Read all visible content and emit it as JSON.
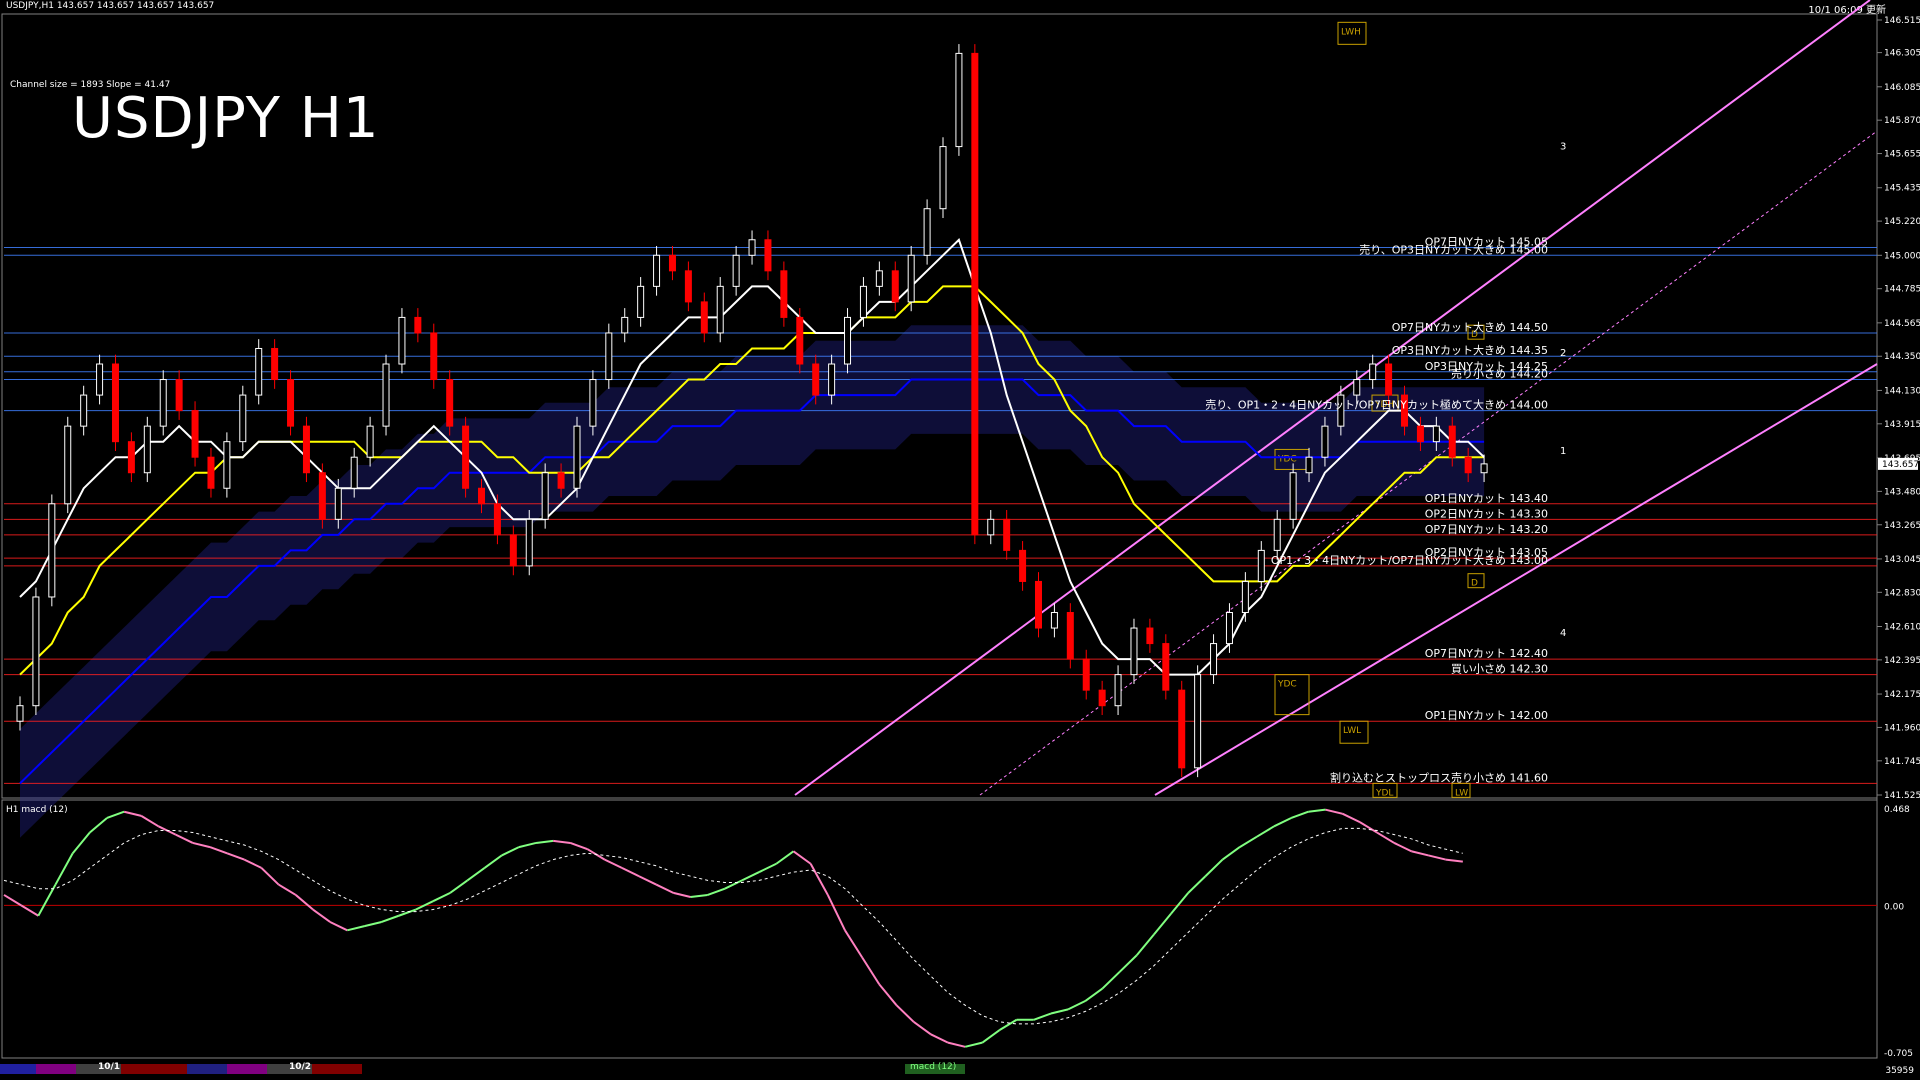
{
  "window": {
    "symbol_info": "USDJPY,H1  143.657 143.657 143.657 143.657",
    "server_time": "10/1 06:09 更新",
    "channel_info": "Channel size = 1893 Slope = 41.47",
    "title": "USDJPY H1",
    "subwindow_label": "H1  macd (12)",
    "corner_number": "35959",
    "bottom_tabs": [
      "10/1",
      "10/2"
    ],
    "macd_tab": "macd (12)"
  },
  "colors": {
    "background": "#000000",
    "bull_candle": "#ffffff",
    "bear_candle": "#ff0000",
    "sma_white": "#ffffff",
    "sma_yellow": "#ffff00",
    "sma_blue": "#0000ff",
    "ichimoku_span": "#008000",
    "channel": "#ff80ff",
    "macd_up": "#80ff80",
    "macd_down": "#ff80c0",
    "macd_signal": "#ffffff"
  },
  "chart_data": {
    "type": "candlestick",
    "title": "USDJPY H1",
    "ylim": [
      141.525,
      146.515
    ],
    "y_ticks": [
      "146.515",
      "146.305",
      "146.085",
      "145.870",
      "145.655",
      "145.435",
      "145.220",
      "145.000",
      "144.785",
      "144.565",
      "144.350",
      "144.130",
      "143.915",
      "143.695",
      "143.480",
      "143.265",
      "143.045",
      "142.830",
      "142.610",
      "142.395",
      "142.175",
      "141.960",
      "141.745",
      "141.525"
    ],
    "current_price": "143.657",
    "closes": [
      142.1,
      142.8,
      143.4,
      143.9,
      144.1,
      144.3,
      143.8,
      143.6,
      143.9,
      144.2,
      144.0,
      143.7,
      143.5,
      143.8,
      144.1,
      144.4,
      144.2,
      143.9,
      143.6,
      143.3,
      143.5,
      143.7,
      143.9,
      144.3,
      144.6,
      144.5,
      144.2,
      143.9,
      143.5,
      143.4,
      143.2,
      143.0,
      143.3,
      143.6,
      143.5,
      143.9,
      144.2,
      144.5,
      144.6,
      144.8,
      145.0,
      144.9,
      144.7,
      144.5,
      144.8,
      145.0,
      145.1,
      144.9,
      144.6,
      144.3,
      144.1,
      144.3,
      144.6,
      144.8,
      144.9,
      144.7,
      145.0,
      145.3,
      145.7,
      146.3,
      143.2,
      143.3,
      143.1,
      142.9,
      142.6,
      142.7,
      142.4,
      142.2,
      142.1,
      142.3,
      142.6,
      142.5,
      142.2,
      141.7,
      142.3,
      142.5,
      142.7,
      142.9,
      143.1,
      143.3,
      143.6,
      143.7,
      143.9,
      144.1,
      144.2,
      144.3,
      144.1,
      143.9,
      143.8,
      143.9,
      143.7,
      143.6,
      143.657
    ],
    "sma_white": [
      142.8,
      142.9,
      143.1,
      143.3,
      143.5,
      143.6,
      143.7,
      143.7,
      143.8,
      143.8,
      143.9,
      143.8,
      143.8,
      143.7,
      143.7,
      143.8,
      143.8,
      143.8,
      143.7,
      143.6,
      143.5,
      143.5,
      143.5,
      143.6,
      143.7,
      143.8,
      143.9,
      143.8,
      143.7,
      143.6,
      143.4,
      143.3,
      143.3,
      143.3,
      143.4,
      143.5,
      143.7,
      143.9,
      144.1,
      144.3,
      144.4,
      144.5,
      144.6,
      144.6,
      144.6,
      144.7,
      144.8,
      144.8,
      144.7,
      144.6,
      144.5,
      144.5,
      144.5,
      144.6,
      144.7,
      144.7,
      144.8,
      144.9,
      145.0,
      145.1,
      144.8,
      144.5,
      144.1,
      143.8,
      143.5,
      143.2,
      142.9,
      142.7,
      142.5,
      142.4,
      142.4,
      142.4,
      142.3,
      142.3,
      142.3,
      142.4,
      142.5,
      142.7,
      142.8,
      143.0,
      143.2,
      143.4,
      143.6,
      143.7,
      143.8,
      143.9,
      144.0,
      144.0,
      143.9,
      143.9,
      143.8,
      143.8,
      143.7
    ],
    "sma_yellow": [
      142.3,
      142.4,
      142.5,
      142.7,
      142.8,
      143.0,
      143.1,
      143.2,
      143.3,
      143.4,
      143.5,
      143.6,
      143.6,
      143.7,
      143.7,
      143.8,
      143.8,
      143.8,
      143.8,
      143.8,
      143.8,
      143.8,
      143.7,
      143.7,
      143.7,
      143.8,
      143.8,
      143.8,
      143.8,
      143.8,
      143.7,
      143.7,
      143.6,
      143.6,
      143.6,
      143.6,
      143.7,
      143.7,
      143.8,
      143.9,
      144.0,
      144.1,
      144.2,
      144.2,
      144.3,
      144.3,
      144.4,
      144.4,
      144.4,
      144.5,
      144.5,
      144.5,
      144.5,
      144.6,
      144.6,
      144.6,
      144.7,
      144.7,
      144.8,
      144.8,
      144.8,
      144.7,
      144.6,
      144.5,
      144.3,
      144.2,
      144.0,
      143.9,
      143.7,
      143.6,
      143.4,
      143.3,
      143.2,
      143.1,
      143.0,
      142.9,
      142.9,
      142.9,
      142.9,
      142.9,
      143.0,
      143.0,
      143.1,
      143.2,
      143.3,
      143.4,
      143.5,
      143.6,
      143.6,
      143.7,
      143.7,
      143.7,
      143.7
    ],
    "sma_blue": [
      141.6,
      141.7,
      141.8,
      141.9,
      142.0,
      142.1,
      142.2,
      142.3,
      142.4,
      142.5,
      142.6,
      142.7,
      142.8,
      142.8,
      142.9,
      143.0,
      143.0,
      143.1,
      143.1,
      143.2,
      143.2,
      143.3,
      143.3,
      143.4,
      143.4,
      143.5,
      143.5,
      143.6,
      143.6,
      143.6,
      143.6,
      143.6,
      143.6,
      143.7,
      143.7,
      143.7,
      143.7,
      143.8,
      143.8,
      143.8,
      143.8,
      143.9,
      143.9,
      143.9,
      143.9,
      144.0,
      144.0,
      144.0,
      144.0,
      144.0,
      144.1,
      144.1,
      144.1,
      144.1,
      144.1,
      144.1,
      144.2,
      144.2,
      144.2,
      144.2,
      144.2,
      144.2,
      144.2,
      144.2,
      144.1,
      144.1,
      144.1,
      144.0,
      144.0,
      144.0,
      143.9,
      143.9,
      143.9,
      143.8,
      143.8,
      143.8,
      143.8,
      143.8,
      143.7,
      143.7,
      143.7,
      143.7,
      143.7,
      143.7,
      143.8,
      143.8,
      143.8,
      143.8,
      143.8,
      143.8,
      143.8,
      143.8,
      143.8
    ],
    "horizontal_levels": [
      {
        "price": 145.05,
        "label": "OP7日NYカット 145.05",
        "color": "#4080ff"
      },
      {
        "price": 145.0,
        "label": "売り、OP3日NYカット大きめ 145.00",
        "color": "#4080ff"
      },
      {
        "price": 144.5,
        "label": "OP7日NYカット大きめ 144.50",
        "color": "#4080ff"
      },
      {
        "price": 144.35,
        "label": "OP3日NYカット大きめ 144.35",
        "color": "#4080ff"
      },
      {
        "price": 144.25,
        "label": "OP3日NYカット 144.25",
        "color": "#4080ff"
      },
      {
        "price": 144.2,
        "label": "売り小さめ 144.20",
        "color": "#4080ff"
      },
      {
        "price": 144.0,
        "label": "売り、OP1・2・4日NYカット/OP7日NYカット極めて大きめ 144.00",
        "color": "#4080ff"
      },
      {
        "price": 143.4,
        "label": "OP1日NYカット 143.40",
        "color": "#ff2020"
      },
      {
        "price": 143.3,
        "label": "OP2日NYカット 143.30",
        "color": "#ff2020"
      },
      {
        "price": 143.2,
        "label": "OP7日NYカット 143.20",
        "color": "#ff2020"
      },
      {
        "price": 143.05,
        "label": "OP2日NYカット 143.05",
        "color": "#ff2020"
      },
      {
        "price": 143.0,
        "label": "OP1・3・4日NYカット/OP7日NYカット大きめ 143.00",
        "color": "#ff2020"
      },
      {
        "price": 142.4,
        "label": "OP7日NYカット 142.40",
        "color": "#ff2020"
      },
      {
        "price": 142.3,
        "label": "買い小さめ 142.30",
        "color": "#ff2020"
      },
      {
        "price": 142.0,
        "label": "OP1日NYカット 142.00",
        "color": "#ff2020"
      },
      {
        "price": 141.6,
        "label": "割り込むとストップロス売り小さめ 141.60",
        "color": "#ff2020"
      }
    ],
    "box_labels": [
      "LWH",
      "YDH",
      "YDC",
      "YDC",
      "YDL",
      "LWL",
      "LW",
      "D",
      "D"
    ],
    "channel_labels": [
      "3",
      "2",
      "1",
      "4"
    ],
    "macd": {
      "ylim": [
        -0.705,
        0.468
      ],
      "y_ticks": [
        "0.468",
        "0.00",
        "-0.705"
      ],
      "main": [
        0.05,
        0.0,
        -0.05,
        0.1,
        0.25,
        0.35,
        0.42,
        0.45,
        0.43,
        0.38,
        0.34,
        0.3,
        0.28,
        0.25,
        0.22,
        0.18,
        0.1,
        0.05,
        -0.02,
        -0.08,
        -0.12,
        -0.1,
        -0.08,
        -0.05,
        -0.02,
        0.02,
        0.06,
        0.12,
        0.18,
        0.24,
        0.28,
        0.3,
        0.31,
        0.3,
        0.27,
        0.22,
        0.18,
        0.14,
        0.1,
        0.06,
        0.04,
        0.05,
        0.08,
        0.12,
        0.16,
        0.2,
        0.26,
        0.2,
        0.05,
        -0.12,
        -0.25,
        -0.38,
        -0.48,
        -0.56,
        -0.62,
        -0.66,
        -0.68,
        -0.66,
        -0.6,
        -0.55,
        -0.55,
        -0.52,
        -0.5,
        -0.46,
        -0.4,
        -0.32,
        -0.24,
        -0.14,
        -0.04,
        0.06,
        0.14,
        0.22,
        0.28,
        0.33,
        0.38,
        0.42,
        0.45,
        0.46,
        0.44,
        0.4,
        0.35,
        0.3,
        0.26,
        0.24,
        0.22,
        0.21
      ],
      "signal": [
        0.12,
        0.1,
        0.08,
        0.08,
        0.12,
        0.18,
        0.24,
        0.3,
        0.34,
        0.36,
        0.36,
        0.35,
        0.33,
        0.31,
        0.29,
        0.26,
        0.22,
        0.17,
        0.12,
        0.07,
        0.03,
        0.0,
        -0.02,
        -0.03,
        -0.03,
        -0.02,
        0.0,
        0.03,
        0.07,
        0.11,
        0.15,
        0.19,
        0.22,
        0.24,
        0.25,
        0.24,
        0.23,
        0.21,
        0.19,
        0.16,
        0.14,
        0.12,
        0.11,
        0.11,
        0.12,
        0.14,
        0.16,
        0.17,
        0.14,
        0.08,
        0.0,
        -0.08,
        -0.17,
        -0.26,
        -0.34,
        -0.42,
        -0.48,
        -0.53,
        -0.56,
        -0.57,
        -0.57,
        -0.56,
        -0.54,
        -0.51,
        -0.47,
        -0.42,
        -0.36,
        -0.29,
        -0.21,
        -0.13,
        -0.05,
        0.03,
        0.1,
        0.17,
        0.23,
        0.28,
        0.32,
        0.35,
        0.37,
        0.37,
        0.36,
        0.34,
        0.32,
        0.29,
        0.27,
        0.25
      ]
    }
  }
}
